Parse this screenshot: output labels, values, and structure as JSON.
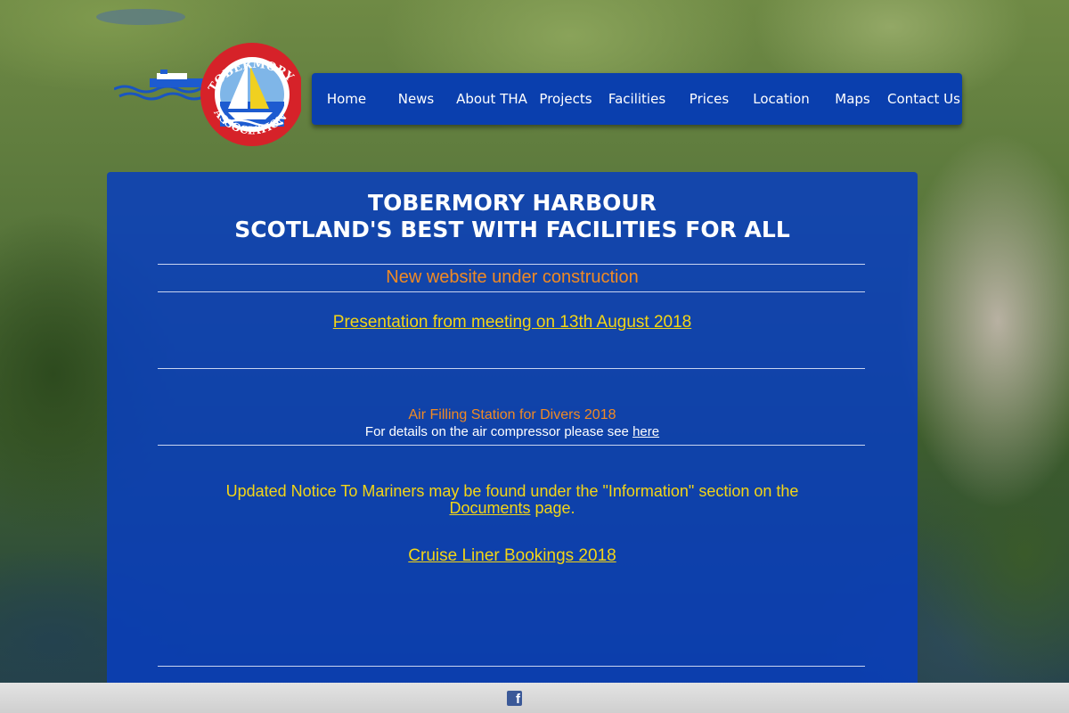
{
  "logo": {
    "text_top": "TOBERMORY HARBOUR",
    "text_bottom": "ASSOCIATION"
  },
  "nav": {
    "items": [
      {
        "label": "Home"
      },
      {
        "label": "News"
      },
      {
        "label": "About THA"
      },
      {
        "label": "Projects"
      },
      {
        "label": "Facilities"
      },
      {
        "label": "Prices"
      },
      {
        "label": "Location"
      },
      {
        "label": "Maps"
      },
      {
        "label": "Contact Us"
      }
    ]
  },
  "main": {
    "title_line1": "TOBERMORY HARBOUR",
    "title_line2": "SCOTLAND'S BEST WITH FACILITIES FOR ALL",
    "construction_notice": "New website under construction",
    "presentation_link": "Presentation from meeting on 13th August 2018",
    "air_station_heading": "Air Filling Station for Divers 2018",
    "air_details_text": "For details on the air compressor please see ",
    "air_details_link": "here",
    "mariners_text_1": "Updated Notice To Mariners may be found under the \"Information\" section on the",
    "mariners_link": "Documents",
    "mariners_text_2": " page.",
    "cruise_link": "Cruise Liner Bookings 2018"
  },
  "footer": {
    "facebook_glyph": "f"
  },
  "colors": {
    "nav_bg": "#0a3fae",
    "panel_bg": "#083ebe",
    "orange_text": "#f08a24",
    "yellow_text": "#f3d516",
    "footer_bg": "#d8d8d8",
    "facebook_blue": "#3b5998"
  },
  "icons": {
    "logo": "harbour-association-badge",
    "facebook": "facebook-icon"
  }
}
